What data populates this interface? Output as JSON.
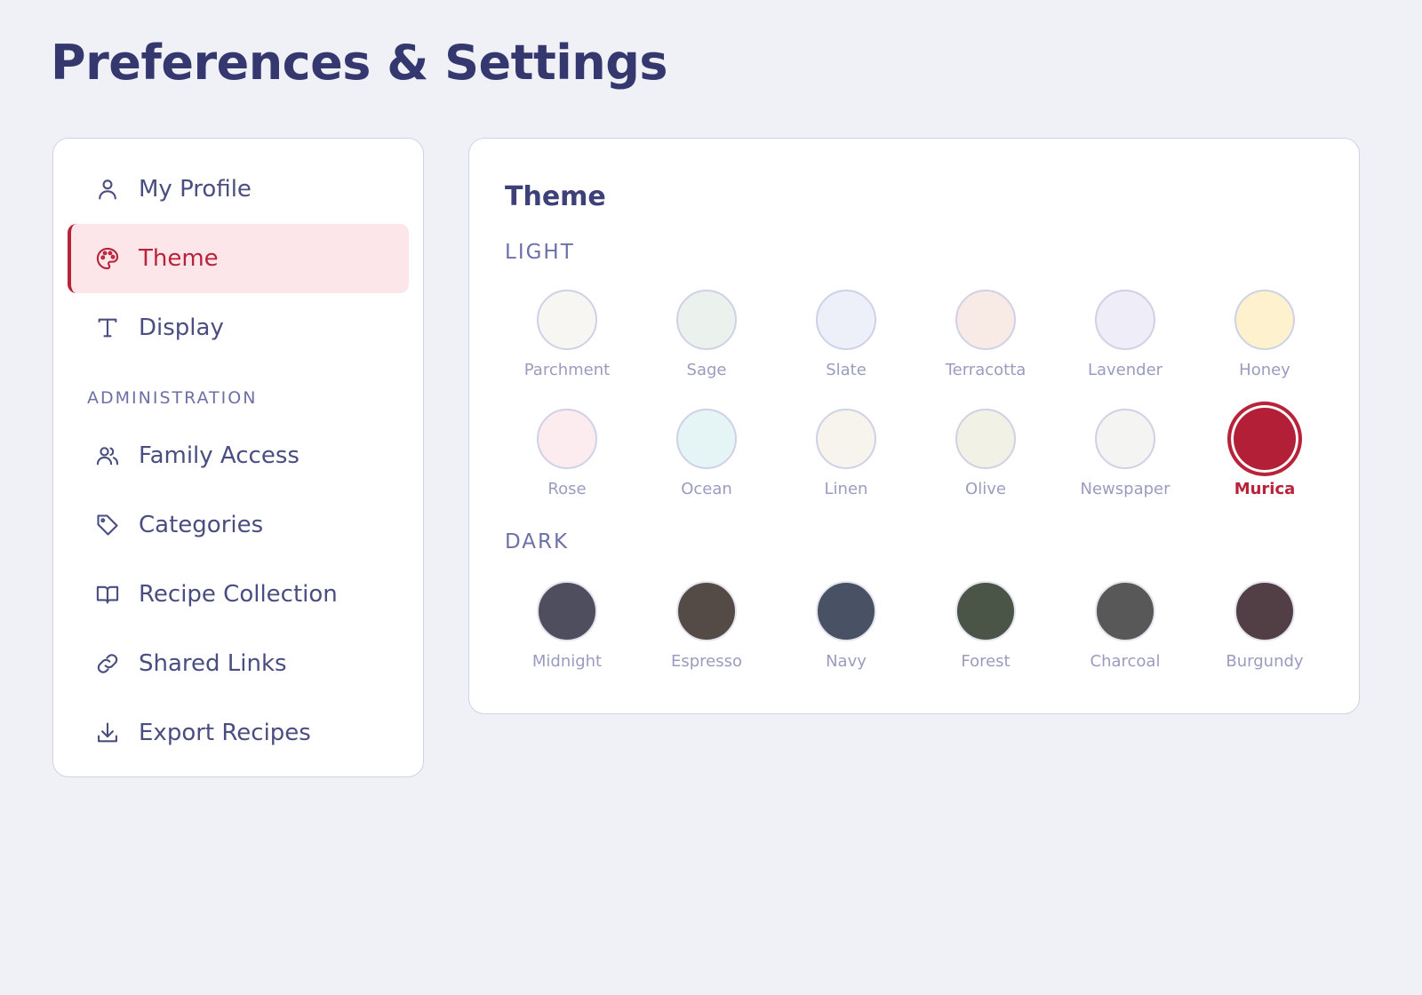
{
  "page": {
    "title": "Preferences & Settings"
  },
  "sidebar": {
    "items": [
      {
        "label": "My Profile",
        "icon": "user-icon",
        "active": false
      },
      {
        "label": "Theme",
        "icon": "palette-icon",
        "active": true
      },
      {
        "label": "Display",
        "icon": "type-icon",
        "active": false
      }
    ],
    "section_label": "ADMINISTRATION",
    "admin_items": [
      {
        "label": "Family Access",
        "icon": "users-icon"
      },
      {
        "label": "Categories",
        "icon": "tag-icon"
      },
      {
        "label": "Recipe Collection",
        "icon": "book-icon"
      },
      {
        "label": "Shared Links",
        "icon": "link-icon"
      },
      {
        "label": "Export Recipes",
        "icon": "download-icon"
      }
    ]
  },
  "theme_panel": {
    "title": "Theme",
    "light_label": "LIGHT",
    "dark_label": "DARK",
    "light_themes": [
      {
        "name": "Parchment",
        "color": "#f8f6f2"
      },
      {
        "name": "Sage",
        "color": "#ebf1ec"
      },
      {
        "name": "Slate",
        "color": "#edf0f8"
      },
      {
        "name": "Terracotta",
        "color": "#f8ebe6"
      },
      {
        "name": "Lavender",
        "color": "#efedf8"
      },
      {
        "name": "Honey",
        "color": "#fdf2cd"
      },
      {
        "name": "Rose",
        "color": "#fcebef"
      },
      {
        "name": "Ocean",
        "color": "#e5f5f5"
      },
      {
        "name": "Linen",
        "color": "#f7f4ee"
      },
      {
        "name": "Olive",
        "color": "#f2f1e5"
      },
      {
        "name": "Newspaper",
        "color": "#f4f4f3"
      },
      {
        "name": "Murica",
        "color": "#b31f36",
        "selected": true
      }
    ],
    "dark_themes": [
      {
        "name": "Midnight",
        "color": "#4f4e5e"
      },
      {
        "name": "Espresso",
        "color": "#544b47"
      },
      {
        "name": "Navy",
        "color": "#485264"
      },
      {
        "name": "Forest",
        "color": "#4a5548"
      },
      {
        "name": "Charcoal",
        "color": "#585858"
      },
      {
        "name": "Burgundy",
        "color": "#523f45"
      }
    ]
  }
}
